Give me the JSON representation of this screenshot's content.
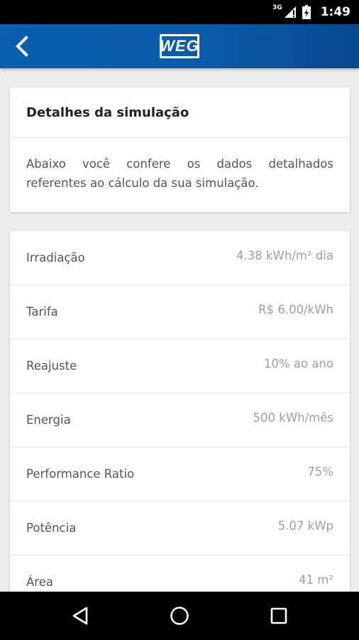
{
  "status_bar": {
    "network": "3G",
    "time": "1:49"
  },
  "app_bar": {
    "logo_text": "WEG"
  },
  "intro_card": {
    "title": "Detalhes da simulação",
    "description": "Abaixo você confere os dados detalhados referentes ao cálculo da sua simulação."
  },
  "details": [
    {
      "label": "Irradiação",
      "value": "4.38 kWh/m² dia"
    },
    {
      "label": "Tarifa",
      "value": "R$ 6.00/kWh"
    },
    {
      "label": "Reajuste",
      "value": "10% ao ano"
    },
    {
      "label": "Energia",
      "value": "500 kWh/mês"
    },
    {
      "label": "Performance Ratio",
      "value": "75%"
    },
    {
      "label": "Potência",
      "value": "5.07 kWp"
    },
    {
      "label": "Área",
      "value": "41 m²"
    }
  ],
  "icons": {
    "back": "back-arrow-icon",
    "nav_back": "nav-back-icon",
    "nav_home": "nav-home-icon",
    "nav_recents": "nav-recents-icon"
  },
  "colors": {
    "app_bar": "#0b5fb0",
    "background": "#ececec"
  }
}
